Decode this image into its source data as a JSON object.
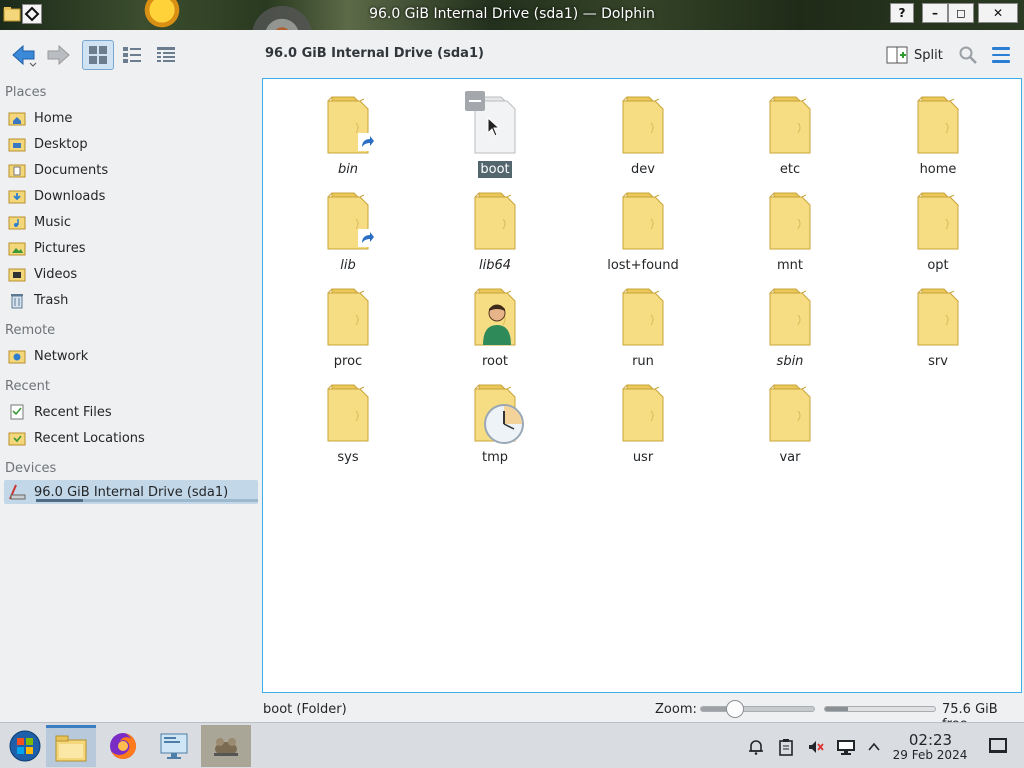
{
  "window": {
    "title": "96.0 GiB Internal Drive (sda1) — Dolphin",
    "buttons": {
      "help": "?",
      "minimize": "–",
      "maximize": "◻",
      "close": "✕"
    }
  },
  "toolbar": {
    "location": "96.0 GiB Internal Drive (sda1)",
    "split_label": "Split",
    "active_view": "icons"
  },
  "sidebar": {
    "sections": {
      "places": "Places",
      "remote": "Remote",
      "recent": "Recent",
      "devices": "Devices"
    },
    "places": [
      {
        "label": "Home",
        "icon": "home-folder-icon"
      },
      {
        "label": "Desktop",
        "icon": "desktop-folder-icon"
      },
      {
        "label": "Documents",
        "icon": "documents-folder-icon"
      },
      {
        "label": "Downloads",
        "icon": "downloads-folder-icon"
      },
      {
        "label": "Music",
        "icon": "music-folder-icon"
      },
      {
        "label": "Pictures",
        "icon": "pictures-folder-icon"
      },
      {
        "label": "Videos",
        "icon": "videos-folder-icon"
      },
      {
        "label": "Trash",
        "icon": "trash-icon"
      }
    ],
    "remote": [
      {
        "label": "Network",
        "icon": "network-folder-icon"
      }
    ],
    "recent": [
      {
        "label": "Recent Files",
        "icon": "recent-files-icon"
      },
      {
        "label": "Recent Locations",
        "icon": "recent-locations-icon"
      }
    ],
    "devices": [
      {
        "label": "96.0 GiB Internal Drive (sda1)",
        "icon": "drive-icon",
        "used_fraction": 0.21
      }
    ]
  },
  "files": [
    {
      "name": "bin",
      "italic": true,
      "emblem": "symlink"
    },
    {
      "name": "boot",
      "selected": true,
      "emblem": "hover"
    },
    {
      "name": "dev"
    },
    {
      "name": "etc"
    },
    {
      "name": "home"
    },
    {
      "name": "lib",
      "italic": true,
      "emblem": "symlink"
    },
    {
      "name": "lib64",
      "italic": true
    },
    {
      "name": "lost+found"
    },
    {
      "name": "mnt"
    },
    {
      "name": "opt"
    },
    {
      "name": "proc"
    },
    {
      "name": "root",
      "emblem": "user"
    },
    {
      "name": "run"
    },
    {
      "name": "sbin",
      "italic": true
    },
    {
      "name": "srv"
    },
    {
      "name": "sys"
    },
    {
      "name": "tmp",
      "emblem": "clock"
    },
    {
      "name": "usr"
    },
    {
      "name": "var"
    }
  ],
  "statusbar": {
    "selection": "boot (Folder)",
    "zoom_label": "Zoom:",
    "zoom_value": 0.3,
    "free_space": "75.6 GiB free",
    "free_used_fraction": 0.21
  },
  "taskbar": {
    "apps": [
      {
        "name": "start-menu",
        "icon": "windows-start-icon"
      },
      {
        "name": "dolphin",
        "icon": "file-manager-icon"
      },
      {
        "name": "firefox",
        "icon": "firefox-icon"
      },
      {
        "name": "system-settings",
        "icon": "settings-monitor-icon"
      },
      {
        "name": "gimp",
        "icon": "gimp-icon"
      }
    ],
    "clock_time": "02:23",
    "clock_date": "29 Feb 2024"
  },
  "colors": {
    "accent": "#3daee9",
    "folder": "#f4d77a",
    "selection": "#53656d",
    "menu": "#2a7fd4"
  }
}
